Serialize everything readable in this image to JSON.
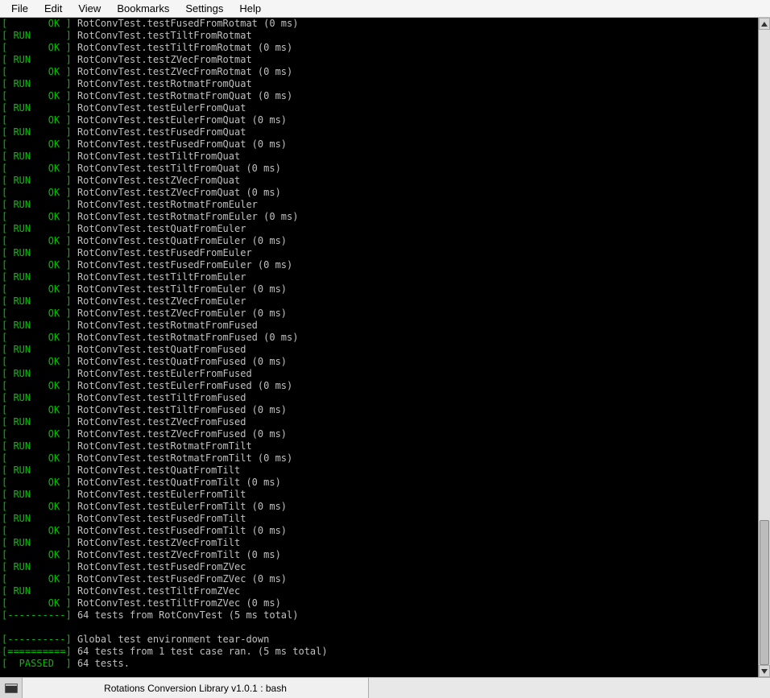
{
  "menu": {
    "file": "File",
    "edit": "Edit",
    "view": "View",
    "bookmarks": "Bookmarks",
    "settings": "Settings",
    "help": "Help"
  },
  "status": {
    "tab": "Rotations Conversion Library v1.0.1 : bash"
  },
  "tags": {
    "ok": "[       OK ]",
    "run": "[ RUN      ]",
    "sep": "[----------]",
    "eq": "[==========]",
    "passed": "[  PASSED  ]"
  },
  "tests": [
    {
      "name": "testFusedFromRotmat",
      "ms": "0"
    },
    {
      "name": "testTiltFromRotmat",
      "ms": "0"
    },
    {
      "name": "testZVecFromRotmat",
      "ms": "0"
    },
    {
      "name": "testRotmatFromQuat",
      "ms": "0"
    },
    {
      "name": "testEulerFromQuat",
      "ms": "0"
    },
    {
      "name": "testFusedFromQuat",
      "ms": "0"
    },
    {
      "name": "testTiltFromQuat",
      "ms": "0"
    },
    {
      "name": "testZVecFromQuat",
      "ms": "0"
    },
    {
      "name": "testRotmatFromEuler",
      "ms": "0"
    },
    {
      "name": "testQuatFromEuler",
      "ms": "0"
    },
    {
      "name": "testFusedFromEuler",
      "ms": "0"
    },
    {
      "name": "testTiltFromEuler",
      "ms": "0"
    },
    {
      "name": "testZVecFromEuler",
      "ms": "0"
    },
    {
      "name": "testRotmatFromFused",
      "ms": "0"
    },
    {
      "name": "testQuatFromFused",
      "ms": "0"
    },
    {
      "name": "testEulerFromFused",
      "ms": "0"
    },
    {
      "name": "testTiltFromFused",
      "ms": "0"
    },
    {
      "name": "testZVecFromFused",
      "ms": "0"
    },
    {
      "name": "testRotmatFromTilt",
      "ms": "0"
    },
    {
      "name": "testQuatFromTilt",
      "ms": "0"
    },
    {
      "name": "testEulerFromTilt",
      "ms": "0"
    },
    {
      "name": "testFusedFromTilt",
      "ms": "0"
    },
    {
      "name": "testZVecFromTilt",
      "ms": "0"
    },
    {
      "name": "testFusedFromZVec",
      "ms": "0"
    },
    {
      "name": "testTiltFromZVec",
      "ms": "0"
    }
  ],
  "suite": "RotConvTest",
  "summary": {
    "suite_line": "64 tests from RotConvTest (5 ms total)",
    "teardown": "Global test environment tear-down",
    "ran": "64 tests from 1 test case ran. (5 ms total)",
    "passed": "64 tests."
  }
}
